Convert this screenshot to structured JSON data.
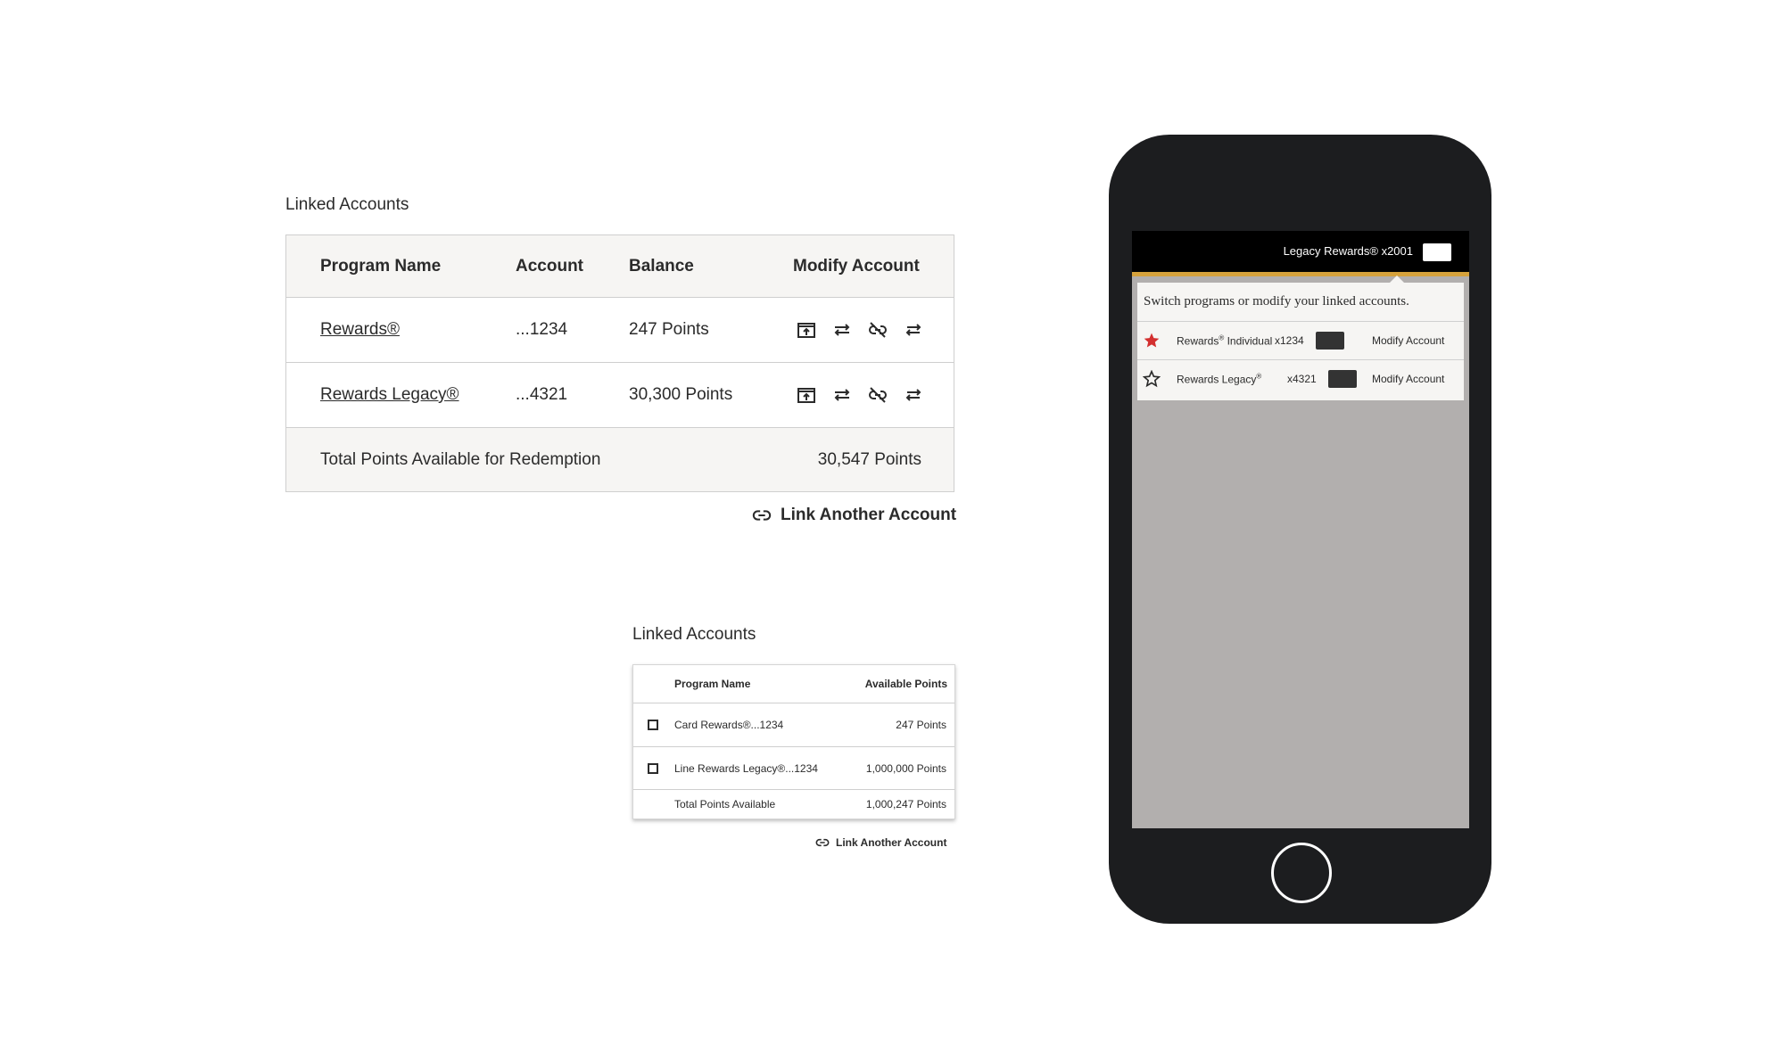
{
  "large_table": {
    "title": "Linked Accounts",
    "headers": {
      "program": "Program Name",
      "account": "Account",
      "balance": "Balance",
      "modify": "Modify Account"
    },
    "rows": [
      {
        "program": "Rewards®",
        "account": "...1234",
        "balance": "247 Points"
      },
      {
        "program": "Rewards Legacy®",
        "account": "...4321",
        "balance": "30,300 Points"
      }
    ],
    "row_icons": [
      "open-account-icon",
      "transfer-icon",
      "unlink-icon",
      "swap-icon"
    ],
    "total_label": "Total Points Available for Redemption",
    "total_value": "30,547 Points",
    "link_label": "Link Another Account"
  },
  "small_table": {
    "title": "Linked Accounts",
    "headers": {
      "program": "Program Name",
      "points": "Available Points"
    },
    "rows": [
      {
        "program": "Card Rewards®...1234",
        "points": "247 Points",
        "checked": false
      },
      {
        "program": "Line Rewards Legacy®...1234",
        "points": "1,000,000 Points",
        "checked": false
      }
    ],
    "total_label": "Total Points Available",
    "total_value": "1,000,247 Points",
    "link_label": "Link Another Account"
  },
  "phone": {
    "topbar_title": "Legacy Rewards® x2001",
    "popover_heading": "Switch programs or modify your linked accounts.",
    "programs": [
      {
        "name": "Rewards",
        "sup": "®",
        "suffix": " Individual",
        "account": "x1234",
        "action": "Modify Account",
        "starred": true
      },
      {
        "name": "Rewards Legacy",
        "sup": "®",
        "suffix": "",
        "account": "x4321",
        "action": "Modify Account",
        "starred": false
      }
    ],
    "colors": {
      "star_active": "#d32f2f",
      "topbar_accent": "#d6a23c",
      "overlay": "#b2afae",
      "frame": "#1c1d1f"
    }
  }
}
